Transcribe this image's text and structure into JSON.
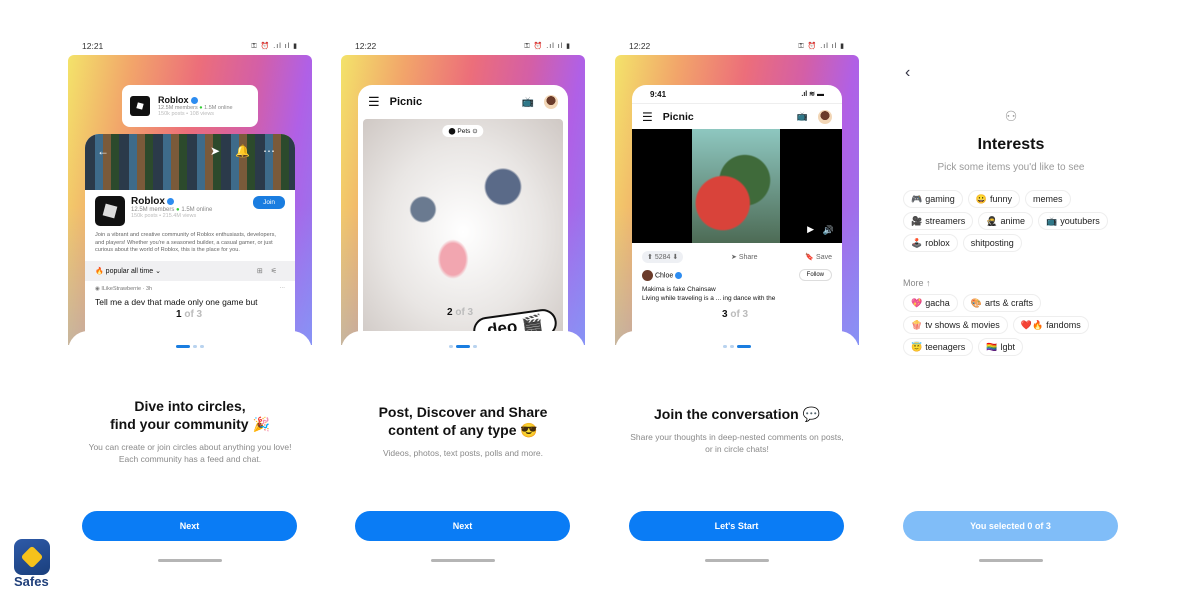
{
  "screens": [
    {
      "status_time": "12:21",
      "status_icons": "⚿ ⏰ .ıl ıl ▮",
      "preview": {
        "mini_card": {
          "name": "Roblox",
          "members": "12.5M members",
          "online": "1.5M online",
          "stats": "150k posts • 108 views"
        },
        "community": {
          "name": "Roblox",
          "members": "12.5M members",
          "online": "1.5M online",
          "stats": "150k posts • 215.4M views",
          "join_label": "Join",
          "description": "Join a vibrant and creative community of Roblox enthusiasts, developers, and players! Whether you're a seasoned builder, a casual gamer, or just curious about the world of Roblox, this is the place for you.",
          "sort_label": "popular all time",
          "post_author": "ILikeStrawberrie",
          "post_time": "3h",
          "post_text": "Tell me a dev that made only one game but"
        },
        "pager_current": "1",
        "pager_total": "of 3"
      },
      "title": "Dive into circles, find your community 🎉",
      "title_line1": "Dive into circles,",
      "title_line2": "find your community 🎉",
      "description": "You can create or join circles about anything you love! Each community has a feed and chat.",
      "button_label": "Next",
      "active_dot": 0
    },
    {
      "status_time": "12:22",
      "status_icons": "⚿ ⏰ .ıl ıl ▮",
      "preview": {
        "app_name": "Picnic",
        "tag": "Pets",
        "sticker": "deo 🎬",
        "pager_current": "2",
        "pager_total": "of 3"
      },
      "title_line1": "Post, Discover and Share",
      "title_line2": "content of any type 😎",
      "description": "Videos, photos, text posts, polls and more.",
      "button_label": "Next",
      "active_dot": 1
    },
    {
      "status_time": "12:22",
      "status_icons": "⚿ ⏰ .ıl ıl ▮",
      "preview": {
        "inner_time": "9:41",
        "app_name": "Picnic",
        "votes": "5284",
        "share_label": "Share",
        "save_label": "Save",
        "author": "Chloe",
        "follow_label": "Follow",
        "post_title": "Makima is fake Chainsaw",
        "post_text": "Living while traveling is a ... ing dance with the",
        "pager_current": "3",
        "pager_total": "of 3"
      },
      "title_line1": "Join the conversation 💬",
      "description": "Share your thoughts in deep-nested comments on posts, or in circle chats!",
      "button_label": "Let's Start",
      "active_dot": 2
    }
  ],
  "interests": {
    "title": "Interests",
    "subtitle": "Pick some items you'd like to see",
    "chips": [
      {
        "emoji": "🎮",
        "label": "gaming"
      },
      {
        "emoji": "😀",
        "label": "funny"
      },
      {
        "emoji": "",
        "label": "memes"
      },
      {
        "emoji": "🎥",
        "label": "streamers"
      },
      {
        "emoji": "🥷",
        "label": "anime"
      },
      {
        "emoji": "📺",
        "label": "youtubers"
      },
      {
        "emoji": "🕹️",
        "label": "roblox"
      },
      {
        "emoji": "",
        "label": "shitposting"
      }
    ],
    "more_label": "More ↑",
    "more_chips": [
      {
        "emoji": "💖",
        "label": "gacha"
      },
      {
        "emoji": "🎨",
        "label": "arts & crafts"
      },
      {
        "emoji": "🍿",
        "label": "tv shows & movies"
      },
      {
        "emoji": "❤️🔥",
        "label": "fandoms"
      },
      {
        "emoji": "😇",
        "label": "teenagers"
      },
      {
        "emoji": "🏳️‍🌈",
        "label": "lgbt"
      }
    ],
    "button_label": "You selected 0 of 3",
    "selected": 0,
    "max": 3
  },
  "watermark": {
    "label": "Safes"
  },
  "colors": {
    "primary": "#0a7cf5",
    "primary_disabled": "#80bdf8"
  }
}
